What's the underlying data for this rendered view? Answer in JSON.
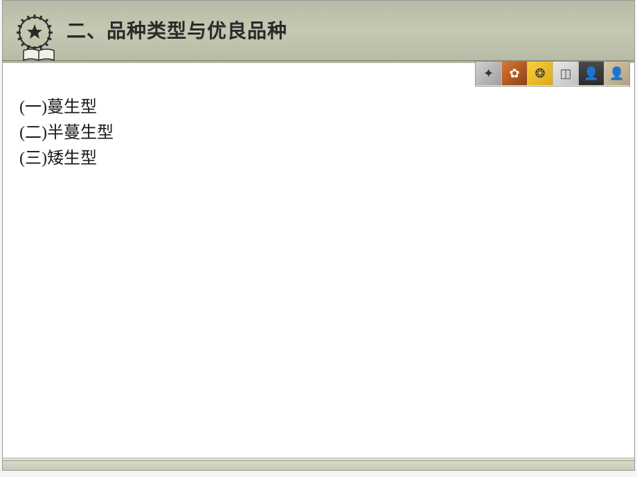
{
  "header": {
    "title": "二、品种类型与优良品种",
    "icon_name": "gear-star-book"
  },
  "content": {
    "lines": [
      "(一)蔓生型",
      "(二)半蔓生型",
      "(三)矮生型"
    ]
  },
  "thumbnails": [
    {
      "glyph": "✦",
      "name": "thumb-compass"
    },
    {
      "glyph": "✿",
      "name": "thumb-hands"
    },
    {
      "glyph": "❂",
      "name": "thumb-sunflower"
    },
    {
      "glyph": "◫",
      "name": "thumb-grid"
    },
    {
      "glyph": "👤",
      "name": "thumb-person-dark"
    },
    {
      "glyph": "👤",
      "name": "thumb-person-sepia"
    }
  ]
}
